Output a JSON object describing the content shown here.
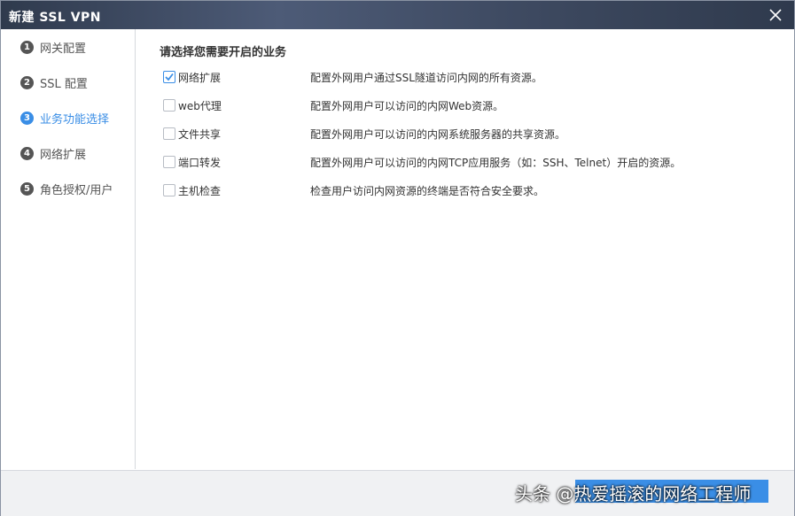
{
  "window": {
    "title": "新建 SSL VPN"
  },
  "sidebar": {
    "steps": [
      {
        "num": "1",
        "label": "网关配置",
        "active": false
      },
      {
        "num": "2",
        "label": "SSL 配置",
        "active": false
      },
      {
        "num": "3",
        "label": "业务功能选择",
        "active": true
      },
      {
        "num": "4",
        "label": "网络扩展",
        "active": false
      },
      {
        "num": "5",
        "label": "角色授权/用户",
        "active": false
      }
    ]
  },
  "main": {
    "title": "请选择您需要开启的业务",
    "options": [
      {
        "label": "网络扩展",
        "checked": true,
        "desc": "配置外网用户通过SSL隧道访问内网的所有资源。"
      },
      {
        "label": "web代理",
        "checked": false,
        "desc": "配置外网用户可以访问的内网Web资源。"
      },
      {
        "label": "文件共享",
        "checked": false,
        "desc": "配置外网用户可以访问的内网系统服务器的共享资源。"
      },
      {
        "label": "端口转发",
        "checked": false,
        "desc": "配置外网用户可以访问的内网TCP应用服务（如：SSH、Telnet）开启的资源。"
      },
      {
        "label": "主机检查",
        "checked": false,
        "desc": "检查用户访问内网资源的终端是否符合安全要求。"
      }
    ]
  },
  "footer": {
    "watermark": "头条 @热爱摇滚的网络工程师"
  },
  "colors": {
    "accent": "#3a8ee6",
    "titlebar": "#3e4a61"
  }
}
